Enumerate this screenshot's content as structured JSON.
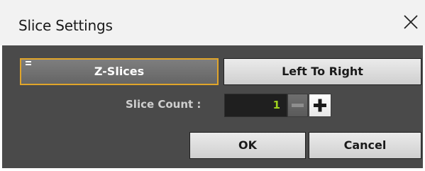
{
  "dialog": {
    "title": "Slice Settings"
  },
  "mode_buttons": {
    "z_slices_label": "Z-Slices",
    "left_to_right_label": "Left To Right"
  },
  "slice_count": {
    "label": "Slice Count :",
    "value": "1"
  },
  "actions": {
    "ok_label": "OK",
    "cancel_label": "Cancel"
  },
  "icons": {
    "close": "close-icon",
    "minus": "minus-icon",
    "plus": "plus-icon"
  },
  "colors": {
    "selected_border": "#e0a52a",
    "value_text": "#9fd21e",
    "panel_background": "#4a4a4a"
  }
}
